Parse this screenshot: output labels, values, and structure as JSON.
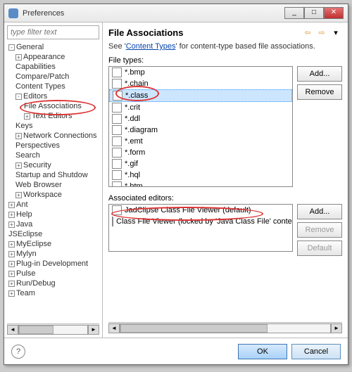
{
  "window": {
    "title": "Preferences"
  },
  "filter": {
    "placeholder": "type filter text"
  },
  "tree": {
    "general": "General",
    "appearance": "Appearance",
    "capabilities": "Capabilities",
    "comparepatch": "Compare/Patch",
    "contenttypes": "Content Types",
    "editors": "Editors",
    "fileassoc": "File Associations",
    "texteditors": "Text Editors",
    "keys": "Keys",
    "netconn": "Network Connections",
    "perspectives": "Perspectives",
    "search": "Search",
    "security": "Security",
    "startup": "Startup and Shutdow",
    "webbrowser": "Web Browser",
    "workspace": "Workspace",
    "ant": "Ant",
    "help": "Help",
    "java": "Java",
    "jseclipse": "JSEclipse",
    "myeclipse": "MyEclipse",
    "mylyn": "Mylyn",
    "plugin": "Plug-in Development",
    "pulse": "Pulse",
    "rundebug": "Run/Debug",
    "team": "Team"
  },
  "right": {
    "title": "File Associations",
    "subtext_pre": "See '",
    "subtext_link": "Content Types",
    "subtext_post": "' for content-type based file associations.",
    "filetypes_label": "File types:",
    "assoc_label": "Associated editors:",
    "add": "Add...",
    "remove": "Remove",
    "default": "Default"
  },
  "filetypes": [
    "*.bmp",
    "*.chain",
    "*.class",
    "*.crit",
    "*.ddl",
    "*.diagram",
    "*.emt",
    "*.form",
    "*.gif",
    "*.hql",
    "*.htm"
  ],
  "editors": [
    "JadClipse Class File Viewer (default)",
    "Class File Viewer (locked by 'Java Class File' content type)"
  ],
  "footer": {
    "ok": "OK",
    "cancel": "Cancel"
  },
  "glyph": {
    "minus": "-",
    "plus": "+",
    "tri": "▾",
    "back": "⇦",
    "fwd": "⇨",
    "left": "◄",
    "right": "►",
    "q": "?"
  }
}
